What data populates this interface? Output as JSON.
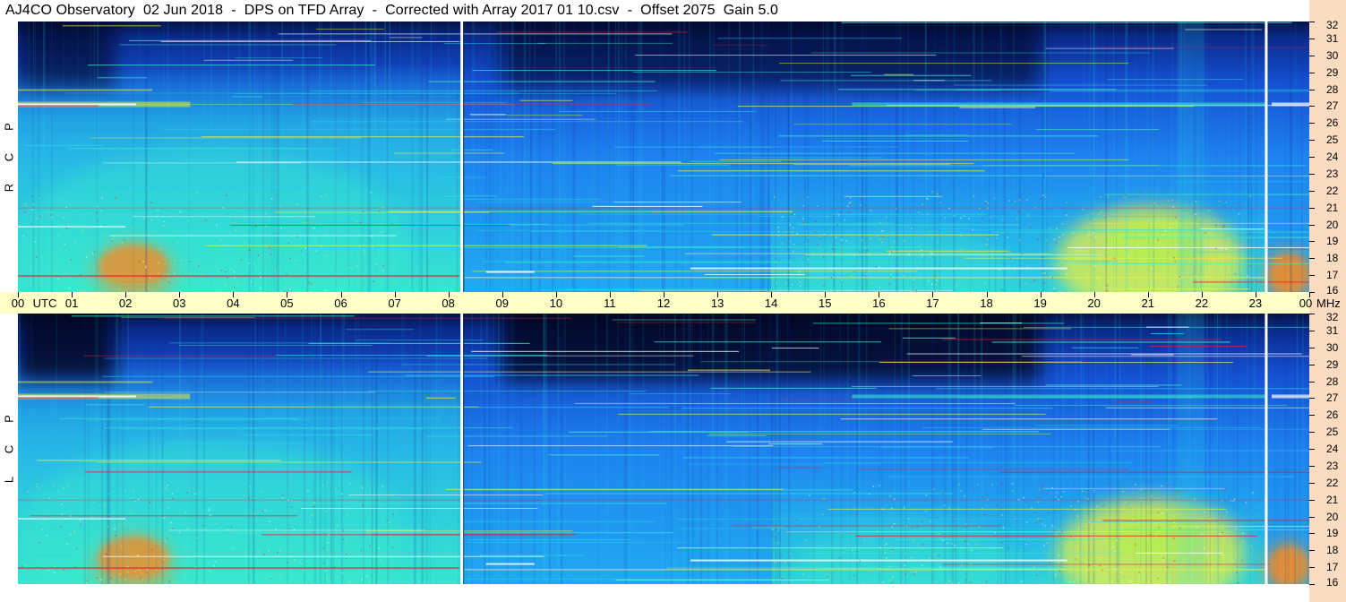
{
  "title": "AJ4CO Observatory  02 Jun 2018  -  DPS on TFD Array  -  Corrected with Array 2017 01 10.csv  -  Offset 2075  Gain 5.0",
  "colors": {
    "deep_navy": "#061446",
    "navy": "#0a2a8c",
    "blue": "#1450d2",
    "mid_blue": "#1e82f0",
    "cyan_blue": "#20aaf0",
    "cyan": "#28d2e6",
    "aqua": "#3cf0c8",
    "green_yellow": "#b4f050",
    "yellow": "#f0f03c",
    "orange": "#f08c28",
    "red": "#e61e32",
    "white": "#ffffff",
    "time_bar": "#ffffc8",
    "freq_strip": "#fcdcc0"
  },
  "chart_data": {
    "type": "heatmap",
    "title": "AJ4CO Observatory  02 Jun 2018  -  DPS on TFD Array  -  Corrected with Array 2017 01 10.csv  -  Offset 2075  Gain 5.0",
    "x_axis": {
      "units_label": "UTC",
      "range_hours": [
        0,
        24
      ],
      "tick_labels": [
        "00",
        "01",
        "02",
        "03",
        "04",
        "05",
        "06",
        "07",
        "08",
        "09",
        "10",
        "11",
        "12",
        "13",
        "14",
        "15",
        "16",
        "17",
        "18",
        "19",
        "20",
        "21",
        "22",
        "23",
        "00"
      ]
    },
    "y_axis": {
      "units_label": "MHz",
      "range_mhz": [
        16,
        32
      ],
      "tick_labels": [
        "32",
        "31",
        "30",
        "29",
        "28",
        "27",
        "26",
        "25",
        "24",
        "23",
        "22",
        "21",
        "20",
        "19",
        "18",
        "17",
        "16"
      ]
    },
    "panels": [
      {
        "name": "rcp",
        "label_letters": [
          "P",
          "C",
          "R"
        ]
      },
      {
        "name": "lcp",
        "label_letters": [
          "P",
          "C",
          "L"
        ]
      }
    ],
    "data_gaps_utc_hours": [
      8.25,
      23.2
    ],
    "persistent_band_mhz": [
      27.1,
      17.4,
      21.0
    ],
    "enhanced_regions": [
      {
        "hours": [
          1.4,
          2.9
        ],
        "mhz": [
          16,
          19.5
        ],
        "level": "orange"
      },
      {
        "hours": [
          19.3,
          22.8
        ],
        "mhz": [
          16,
          22
        ],
        "level": "yellow"
      },
      {
        "hours": [
          14.5,
          18.5
        ],
        "mhz": [
          16,
          20.5
        ],
        "level": "aqua"
      },
      {
        "hours": [
          0.0,
          7.2
        ],
        "mhz": [
          16,
          26
        ],
        "level": "aqua"
      },
      {
        "hours": [
          23.2,
          24.0
        ],
        "mhz": [
          16,
          19
        ],
        "level": "orange"
      }
    ],
    "dark_regions": [
      {
        "hours": [
          0.0,
          1.8
        ],
        "mhz": [
          28,
          32
        ]
      },
      {
        "hours": [
          9.0,
          19.0
        ],
        "mhz": [
          28,
          32
        ]
      }
    ]
  }
}
